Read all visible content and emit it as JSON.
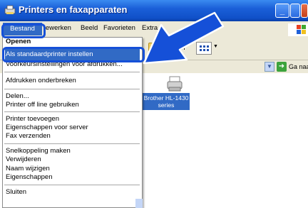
{
  "window": {
    "title": "Printers en faxapparaten"
  },
  "menubar": {
    "items": [
      "Bestand",
      "ewerken",
      "Beeld",
      "Favorieten",
      "Extra"
    ]
  },
  "toolbar": {
    "partial_label": "n"
  },
  "address_bar": {
    "go_label": "Ga naar"
  },
  "file_menu": {
    "items": [
      "Openen",
      "Als standaardprinter instellen",
      "Voorkeursinstellingen voor afdrukken...",
      "Afdrukken onderbreken",
      "Delen...",
      "Printer off line gebruiken",
      "Printer toevoegen",
      "Eigenschappen voor server",
      "Fax verzenden",
      "Snelkoppeling maken",
      "Verwijderen",
      "Naam wijzigen",
      "Eigenschappen",
      "Sluiten"
    ]
  },
  "content": {
    "printer_name": "Brother HL-1430 series"
  },
  "annotation": {
    "arrow_color": "#1550d8",
    "highlight_color": "#1550d8"
  }
}
